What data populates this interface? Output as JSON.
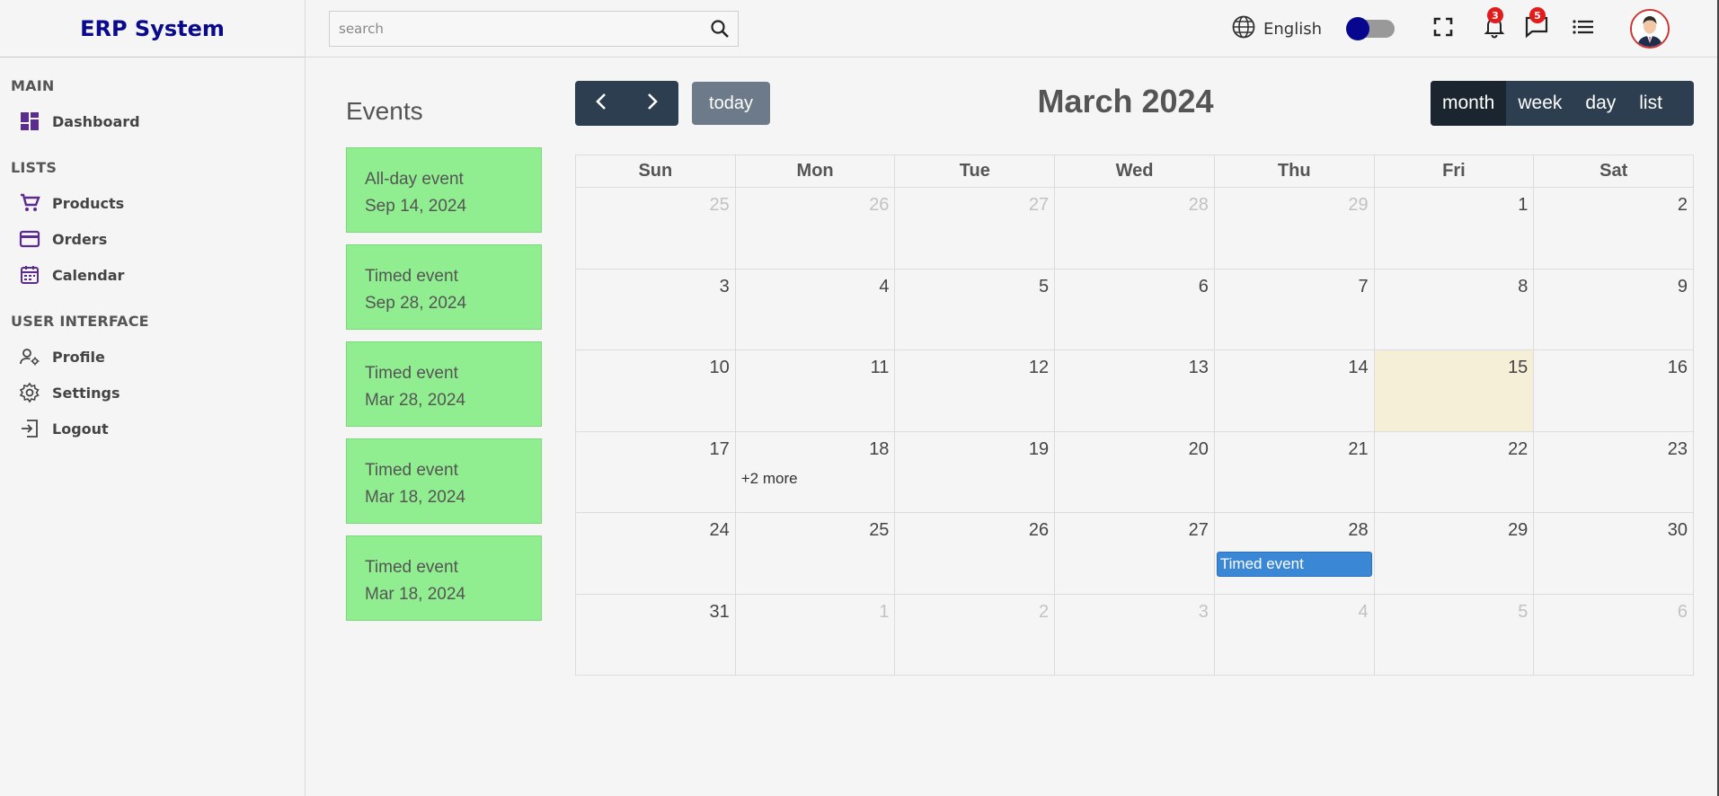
{
  "app": {
    "title": "ERP System"
  },
  "sidebar": {
    "sections": [
      {
        "title": "MAIN",
        "items": [
          {
            "label": "Dashboard",
            "icon": "dashboard-icon"
          }
        ]
      },
      {
        "title": "LISTS",
        "items": [
          {
            "label": "Products",
            "icon": "cart-icon"
          },
          {
            "label": "Orders",
            "icon": "credit-card-icon"
          },
          {
            "label": "Calendar",
            "icon": "calendar-icon"
          }
        ]
      },
      {
        "title": "USER INTERFACE",
        "items": [
          {
            "label": "Profile",
            "icon": "profile-settings-icon"
          },
          {
            "label": "Settings",
            "icon": "gear-icon"
          },
          {
            "label": "Logout",
            "icon": "logout-icon"
          }
        ]
      }
    ]
  },
  "topbar": {
    "search_placeholder": "search",
    "language": "English",
    "notifications_count": "3",
    "messages_count": "5"
  },
  "events_panel": {
    "title": "Events",
    "events": [
      {
        "title": "All-day event",
        "date": "Sep 14, 2024"
      },
      {
        "title": "Timed event",
        "date": "Sep 28, 2024"
      },
      {
        "title": "Timed event",
        "date": "Mar 28, 2024"
      },
      {
        "title": "Timed event",
        "date": "Mar 18, 2024"
      },
      {
        "title": "Timed event",
        "date": "Mar 18, 2024"
      }
    ]
  },
  "calendar": {
    "title": "March 2024",
    "today_label": "today",
    "views": [
      "month",
      "week",
      "day",
      "list"
    ],
    "active_view": "month",
    "weekdays": [
      "Sun",
      "Mon",
      "Tue",
      "Wed",
      "Thu",
      "Fri",
      "Sat"
    ],
    "weeks": [
      [
        {
          "d": "25",
          "o": true
        },
        {
          "d": "26",
          "o": true
        },
        {
          "d": "27",
          "o": true
        },
        {
          "d": "28",
          "o": true
        },
        {
          "d": "29",
          "o": true
        },
        {
          "d": "1"
        },
        {
          "d": "2"
        }
      ],
      [
        {
          "d": "3"
        },
        {
          "d": "4"
        },
        {
          "d": "5"
        },
        {
          "d": "6"
        },
        {
          "d": "7"
        },
        {
          "d": "8"
        },
        {
          "d": "9"
        }
      ],
      [
        {
          "d": "10"
        },
        {
          "d": "11"
        },
        {
          "d": "12"
        },
        {
          "d": "13"
        },
        {
          "d": "14"
        },
        {
          "d": "15",
          "today": true
        },
        {
          "d": "16"
        }
      ],
      [
        {
          "d": "17"
        },
        {
          "d": "18",
          "more": "+2 more"
        },
        {
          "d": "19"
        },
        {
          "d": "20"
        },
        {
          "d": "21"
        },
        {
          "d": "22"
        },
        {
          "d": "23"
        }
      ],
      [
        {
          "d": "24"
        },
        {
          "d": "25"
        },
        {
          "d": "26"
        },
        {
          "d": "27"
        },
        {
          "d": "28",
          "event": "Timed event"
        },
        {
          "d": "29"
        },
        {
          "d": "30"
        }
      ],
      [
        {
          "d": "31"
        },
        {
          "d": "1",
          "o": true
        },
        {
          "d": "2",
          "o": true
        },
        {
          "d": "3",
          "o": true
        },
        {
          "d": "4",
          "o": true
        },
        {
          "d": "5",
          "o": true
        },
        {
          "d": "6",
          "o": true
        }
      ]
    ]
  },
  "colors": {
    "brand": "#0a0a8c",
    "sidebar_icon": "#5b2c8f",
    "event_card": "#90ee90",
    "event_chip": "#3a87d6",
    "today_cell": "#f5efd8",
    "button_dark": "#2c3e50"
  }
}
